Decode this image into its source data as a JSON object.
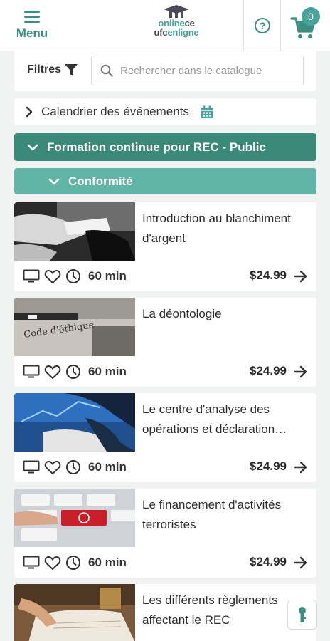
{
  "header": {
    "menu_label": "Menu",
    "logo_line1_a": "online",
    "logo_line1_b": "ce",
    "logo_line2_a": "ufc",
    "logo_line2_b": "enligne",
    "cart_count": "0",
    "help_glyph": "?"
  },
  "filter": {
    "label": "Filtres",
    "search_placeholder": "Rechercher dans le catalogue"
  },
  "calendar": {
    "label": "Calendrier des événements"
  },
  "sections": {
    "main": "Formation continue pour REC - Public",
    "sub": "Conformité"
  },
  "courses": [
    {
      "title": "Introduction au blanchiment d'argent",
      "duration": "60 min",
      "price": "$24.99"
    },
    {
      "title": "La déontologie",
      "duration": "60 min",
      "price": "$24.99"
    },
    {
      "title": "Le centre d'analyse des opérations et déclaration…",
      "duration": "60 min",
      "price": "$24.99"
    },
    {
      "title": "Le financement d'activités terroristes",
      "duration": "60 min",
      "price": "$24.99"
    },
    {
      "title": "Les différents règlements affectant le REC",
      "duration": "",
      "price": ""
    }
  ],
  "thumb_text": {
    "ethics": "Code d'éthique"
  },
  "icons": {
    "menu": "hamburger-icon",
    "help": "help-icon",
    "cart": "cart-icon",
    "filter": "funnel-icon",
    "search": "search-icon",
    "calendar": "calendar-icon",
    "chevron_right": "chevron-right-icon",
    "chevron_down": "chevron-down-icon",
    "monitor": "monitor-icon",
    "heart": "heart-icon",
    "clock": "clock-icon",
    "arrow": "arrow-right-icon",
    "key": "keyhole-icon"
  },
  "colors": {
    "brand": "#3b8f7e",
    "section_dark": "#3b8a79",
    "section_light": "#62b5a6",
    "badge": "#4aa39a",
    "background": "#f1f2f2"
  }
}
